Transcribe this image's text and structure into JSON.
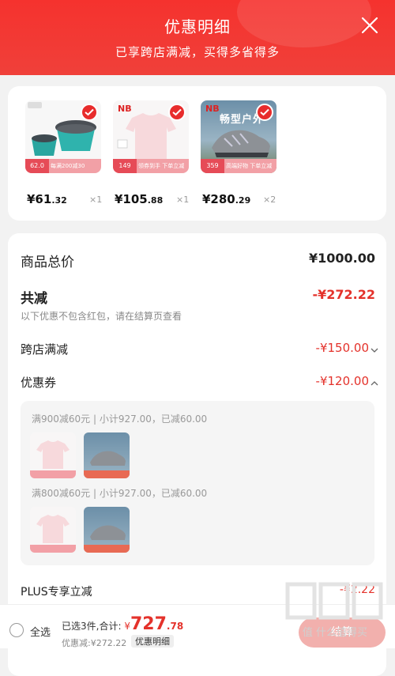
{
  "header": {
    "title": "优惠明细",
    "subtitle": "已享跨店满减，买得多省得多"
  },
  "products": [
    {
      "price_int": "¥61",
      "price_dec": ".32",
      "qty": "×1",
      "tag_price": "62.0",
      "tag_text": "每满200减30"
    },
    {
      "price_int": "¥105",
      "price_dec": ".88",
      "qty": "×1",
      "tag_price": "149",
      "tag_text": "领券到手 下单立减 100元"
    },
    {
      "price_int": "¥280",
      "price_dec": ".29",
      "qty": "×2",
      "tag_price": "359",
      "tag_text": "高端好物 下单立减 100元",
      "banner_text": "畅型户外"
    }
  ],
  "summary": {
    "total_label": "商品总价",
    "total_value": "¥1000.00",
    "reduce_label": "共减",
    "reduce_value": "-¥272.22",
    "note": "以下优惠不包含红包，请在结算页查看",
    "cross_store_label": "跨店满减",
    "cross_store_value": "-¥150.00",
    "coupon_label": "优惠券",
    "coupon_value": "-¥120.00",
    "coupon_lines": [
      "满900减60元 | 小计927.00，已减60.00",
      "满800减60元 | 小计927.00，已减60.00"
    ],
    "plus_label": "PLUS专享立减",
    "plus_value": "-¥2.22"
  },
  "bottom_bar": {
    "select_all": "全选",
    "selected_text": "已选3件,合计:",
    "total_prefix": "¥",
    "total_int": "727",
    "total_dec": ".78",
    "discount_text": "优惠减:¥272.22",
    "details_button": "优惠明细",
    "checkout_button": "结算"
  },
  "watermark": "值 什么值得买"
}
